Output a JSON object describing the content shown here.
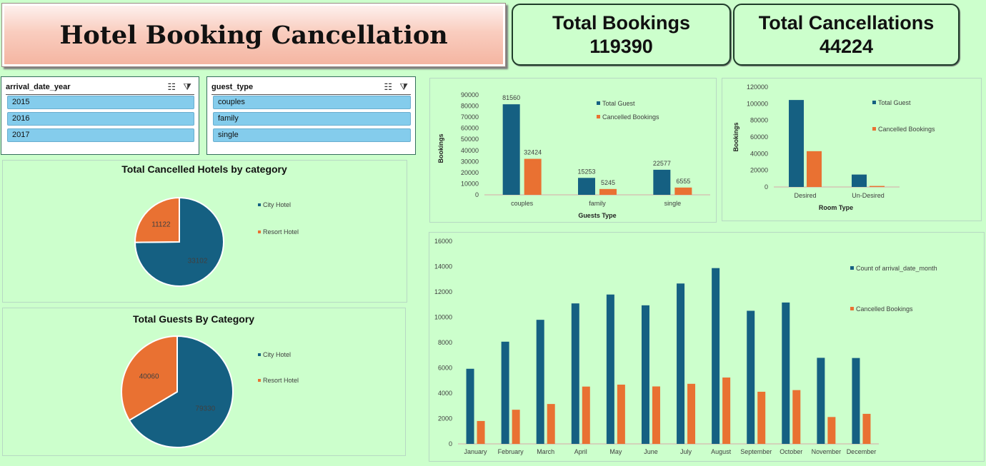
{
  "title": "Hotel Booking Cancellation",
  "kpis": {
    "bookings": {
      "label": "Total Bookings",
      "value": "119390"
    },
    "cancellations": {
      "label": "Total Cancellations",
      "value": "44224"
    }
  },
  "slicers": {
    "year": {
      "title": "arrival_date_year",
      "items": [
        "2015",
        "2016",
        "2017"
      ]
    },
    "guest": {
      "title": "guest_type",
      "items": [
        "couples",
        "family",
        "single"
      ]
    }
  },
  "colors": {
    "blue": "#156082",
    "orange": "#e97132"
  },
  "chart_data": [
    {
      "id": "pie_cancelled",
      "type": "pie",
      "title": "Total Cancelled Hotels by category",
      "categories": [
        "City Hotel",
        "Resort Hotel"
      ],
      "values": [
        33102,
        11122
      ],
      "labels": [
        "33102",
        "11122"
      ],
      "legend": "right"
    },
    {
      "id": "pie_guests",
      "type": "pie",
      "title": "Total Guests By Category",
      "categories": [
        "City Hotel",
        "Resort Hotel"
      ],
      "values": [
        79330,
        40060
      ],
      "labels": [
        "79330",
        "40060"
      ],
      "legend": "right"
    },
    {
      "id": "bar_guest_type",
      "type": "bar",
      "categories": [
        "couples",
        "family",
        "single"
      ],
      "series": [
        {
          "name": "Total Guest",
          "values": [
            81560,
            15253,
            22577
          ]
        },
        {
          "name": "Cancelled Bookings",
          "values": [
            32424,
            5245,
            6555
          ]
        }
      ],
      "xlabel": "Guests Type",
      "ylabel": "Bookings",
      "ylim": [
        0,
        90000
      ],
      "yticks": [
        "0",
        "10000",
        "20000",
        "30000",
        "40000",
        "50000",
        "60000",
        "70000",
        "80000",
        "90000"
      ],
      "data_labels": true,
      "legend": "top-right"
    },
    {
      "id": "bar_room_type",
      "type": "bar",
      "categories": [
        "Desired",
        "Un-Desired"
      ],
      "series": [
        {
          "name": "Total Guest",
          "values": [
            104470,
            14920
          ]
        },
        {
          "name": "Cancelled Bookings",
          "values": [
            43000,
            1224
          ]
        }
      ],
      "xlabel": "Room Type",
      "ylabel": "Bookings",
      "ylim": [
        0,
        120000
      ],
      "yticks": [
        "0",
        "20000",
        "40000",
        "60000",
        "80000",
        "100000",
        "120000"
      ],
      "legend": "top-right"
    },
    {
      "id": "bar_months",
      "type": "bar",
      "categories": [
        "January",
        "February",
        "March",
        "April",
        "May",
        "June",
        "July",
        "August",
        "September",
        "October",
        "November",
        "December"
      ],
      "series": [
        {
          "name": "Count of arrival_date_month",
          "values": [
            5929,
            8068,
            9794,
            11089,
            11791,
            10939,
            12661,
            13877,
            10508,
            11160,
            6794,
            6780
          ]
        },
        {
          "name": "Cancelled Bookings",
          "values": [
            1807,
            2696,
            3149,
            4524,
            4677,
            4535,
            4742,
            5239,
            4116,
            4246,
            2122,
            2371
          ]
        }
      ],
      "ylim": [
        0,
        16000
      ],
      "yticks": [
        "0",
        "2000",
        "4000",
        "6000",
        "8000",
        "10000",
        "12000",
        "14000",
        "16000"
      ],
      "legend": "top-right"
    }
  ]
}
